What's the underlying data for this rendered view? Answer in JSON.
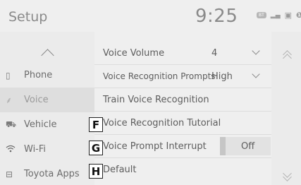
{
  "header": {
    "title": "Setup",
    "time": "9:25",
    "bt_label": "BT"
  },
  "sidebar": {
    "items": [
      {
        "label": "Phone"
      },
      {
        "label": "Voice"
      },
      {
        "label": "Vehicle"
      },
      {
        "label": "Wi-Fi"
      },
      {
        "label": "Toyota Apps"
      }
    ]
  },
  "main": {
    "rows": [
      {
        "label": "Voice Volume",
        "value": "4"
      },
      {
        "label": "Voice Recognition Prompts",
        "value": "High"
      },
      {
        "label": "Train Voice Recognition"
      },
      {
        "label": "Voice Recognition Tutorial"
      },
      {
        "label": "Voice Prompt Interrupt",
        "toggle": "Off"
      },
      {
        "label": "Default"
      }
    ]
  },
  "markers": [
    "F",
    "G",
    "H"
  ]
}
